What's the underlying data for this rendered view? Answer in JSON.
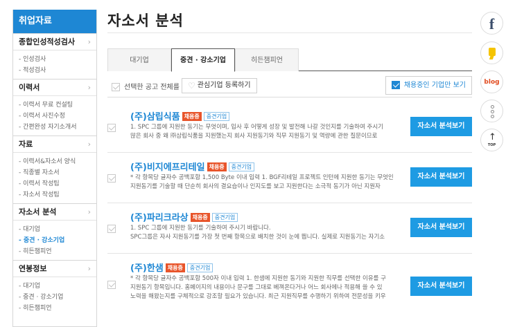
{
  "sidebar": {
    "header": "취업자료",
    "sections": [
      {
        "title": "종합인성적성검사",
        "items": [
          "인성검사",
          "적성검사"
        ],
        "active": -1
      },
      {
        "title": "이력서",
        "items": [
          "이력서 무료 컨설팅",
          "이력서 사진수정",
          "간편완성 자기소개서"
        ],
        "active": -1
      },
      {
        "title": "자료",
        "items": [
          "이력서&자소서 양식",
          "직종별 자소서",
          "이력서 작성팁",
          "자소서 작성팁"
        ],
        "active": -1
      },
      {
        "title": "자소서 분석",
        "items": [
          "대기업",
          "중견 · 강소기업",
          "히든챔피언"
        ],
        "active": 1
      },
      {
        "title": "연봉정보",
        "items": [
          "대기업",
          "중견 · 강소기업",
          "히든챔피언"
        ],
        "active": -1
      }
    ]
  },
  "page": {
    "title": "자소서 분석"
  },
  "tabs": [
    "대기업",
    "중견 · 강소기업",
    "히든챔피언"
  ],
  "toolbar": {
    "select_all": "선택한 공고 전체를",
    "favorite": "관심기업 등록하기",
    "hiring_only": "채용중인 기업만 보기"
  },
  "jobs": [
    {
      "company": "(주)삼립식품",
      "badge": "채용중",
      "tag": "중견기업",
      "lines": [
        "1. SPC 그룹에 지원한 동기는 무엇이며, 입사 후 어떻게 성장 및 발전해 나갈 것인지를 기술하여 주시기",
        "많은 회사 중 왜 ㈜삼립식품을 지원했는지 회사 지원동기와 직무 지원동기 및 역량에 관한 질문이므로"
      ],
      "button": "자소서 분석보기"
    },
    {
      "company": "(주)비지에프리테일",
      "badge": "채용중",
      "tag": "중견기업",
      "lines": [
        "* 각 항목당 글자수 공백포함 1,500 Byte 이내 입력 1. BGF리테일 프로젝트 인턴에 지원한 동기는 무엇인",
        "지원동기를 기술할 때 단순히 회사의 결요습이나 인지도를 보고 지원한다는 소극적 동기가 아닌 지원자"
      ],
      "button": "자소서 분석보기"
    },
    {
      "company": "(주)파리크라상",
      "badge": "채용중",
      "tag": "중견기업",
      "lines": [
        "1. SPC 그룹에 지원한 동기를 기술하여 주시기 바랍니다.",
        "SPC그룹은 자사 지원동기를 가장 첫 번째 항목으로 배치한 것이 눈에 띕니다. 실제로 지원동기는 자기소"
      ],
      "button": "자소서 분석보기"
    },
    {
      "company": "(주)한샘",
      "badge": "채용중",
      "tag": "중견기업",
      "lines": [
        "* 각 항목당 글자수 공백포함 500자 이내 입력 1. 한샘에 지원한 동기와 지원한 직무를 선택한 이유를 구",
        "지원동기 항목입니다. 홈페이지의 내용이나 문구를 그대로 베껴온다거나 어느 회사에나 적용해 쓸 수 있",
        "노력을 해왔는지를 구체적으로 강조할 필요가 있습니다. 최근 지원직무를 수행하기 위하여 전문성을 키우"
      ],
      "button": "자소서 분석보기"
    }
  ],
  "share": {
    "facebook_icon": "facebook-icon",
    "story_icon": "kakaostory-icon",
    "blog_label": "blog",
    "more_icon": "more-icon",
    "top_label": "TOP"
  },
  "colors": {
    "accent": "#1e87d4",
    "badge": "#e8542a",
    "button": "#1e9be3"
  }
}
